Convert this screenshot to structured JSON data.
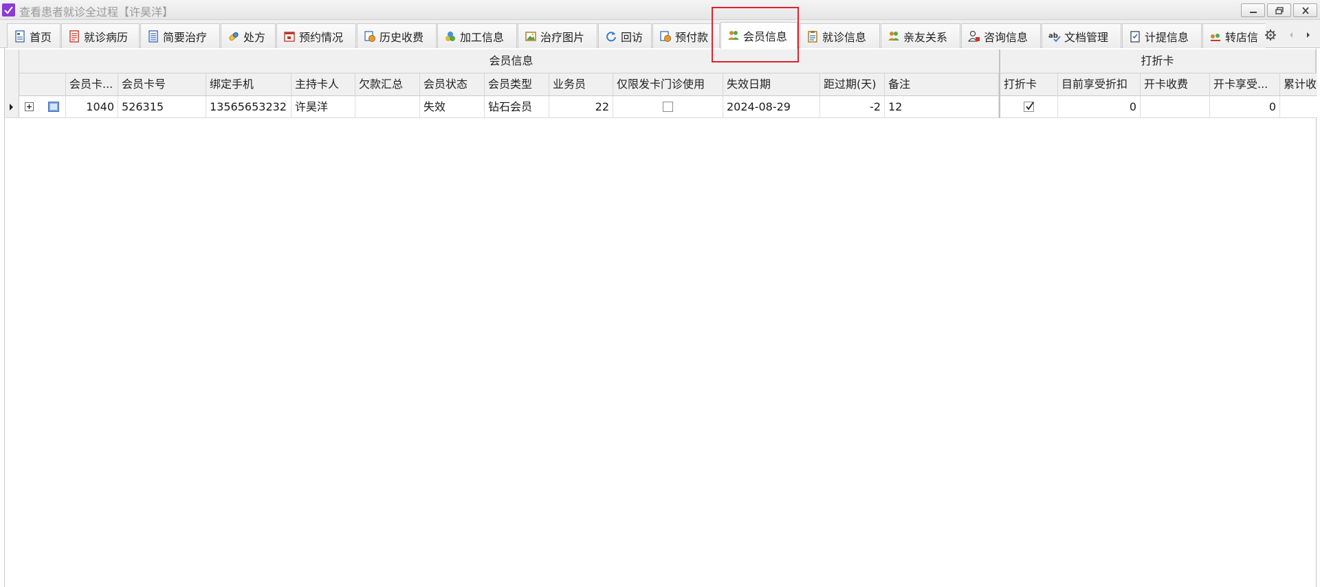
{
  "window": {
    "title": "查看患者就诊全过程【许昊洋】"
  },
  "tabs": [
    {
      "label": "首页",
      "icon": "home-doc-icon"
    },
    {
      "label": "就诊病历",
      "icon": "medical-record-icon"
    },
    {
      "label": "简要治疗",
      "icon": "notes-icon"
    },
    {
      "label": "处方",
      "icon": "pill-icon"
    },
    {
      "label": "预约情况",
      "icon": "calendar-icon"
    },
    {
      "label": "历史收费",
      "icon": "fee-history-icon"
    },
    {
      "label": "加工信息",
      "icon": "processing-icon"
    },
    {
      "label": "治疗图片",
      "icon": "image-icon"
    },
    {
      "label": "回访",
      "icon": "refresh-icon"
    },
    {
      "label": "预付款",
      "icon": "prepay-icon"
    },
    {
      "label": "会员信息",
      "icon": "members-icon",
      "active": true
    },
    {
      "label": "就诊信息",
      "icon": "clipboard-icon"
    },
    {
      "label": "亲友关系",
      "icon": "relatives-icon"
    },
    {
      "label": "咨询信息",
      "icon": "consult-user-icon"
    },
    {
      "label": "文档管理",
      "icon": "spellcheck-icon"
    },
    {
      "label": "计提信息",
      "icon": "checklist-icon"
    },
    {
      "label": "转店信",
      "icon": "transfer-icon"
    }
  ],
  "colors": {
    "title_check": "#8a3ad6",
    "highlight_box": "#e0202a"
  },
  "grid": {
    "bands": {
      "member": "会员信息",
      "discount": "打折卡"
    },
    "columns": {
      "card_level": "会员卡...",
      "card_no": "会员卡号",
      "phone": "绑定手机",
      "holder": "主持卡人",
      "debt": "欠款汇总",
      "status": "会员状态",
      "type": "会员类型",
      "staff": "业务员",
      "clinic_only": "仅限发卡门诊使用",
      "expire": "失效日期",
      "days_overdue": "距过期(天)",
      "remark": "备注",
      "discount_card": "打折卡",
      "current_discount": "目前享受折扣",
      "open_fee": "开卡收费",
      "open_enjoy": "开卡享受...",
      "accum": "累计收"
    },
    "rows": [
      {
        "card_level": "1040",
        "card_no": "526315",
        "phone": "13565653232",
        "holder": "许昊洋",
        "debt": "",
        "status": "失效",
        "type": "钻石会员",
        "staff": "22",
        "clinic_only": false,
        "expire": "2024-08-29",
        "days_overdue": "-2",
        "remark": "12",
        "discount_card": true,
        "current_discount": "0",
        "open_fee": "",
        "open_enjoy": "0",
        "accum": ""
      }
    ]
  }
}
